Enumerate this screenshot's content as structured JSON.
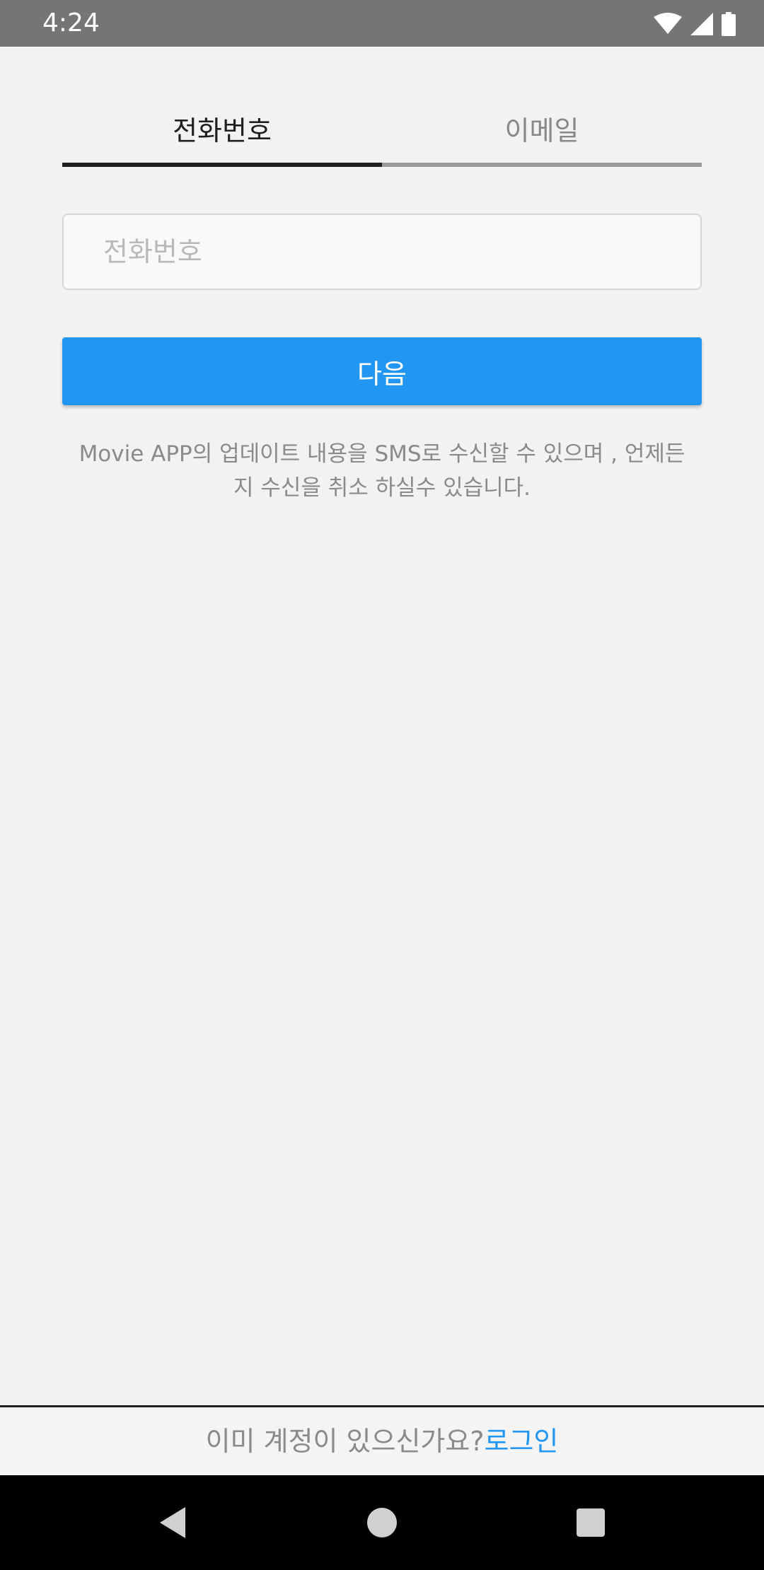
{
  "status_bar": {
    "time": "4:24",
    "icons": [
      "wifi-icon",
      "cell-signal-icon",
      "battery-icon"
    ]
  },
  "tabs": [
    {
      "label": "전화번호",
      "selected": true
    },
    {
      "label": "이메일",
      "selected": false
    }
  ],
  "phone_input": {
    "value": "",
    "placeholder": "전화번호"
  },
  "next_button": {
    "label": "다음"
  },
  "notice": {
    "line1": "Movie APP의 업데이트 내용을 SMS로 수신할 수 있으며 , 언제든",
    "line2": "지 수신을 취소 하실수 있습니다."
  },
  "footer": {
    "question": "이미 계정이 있으신가요?",
    "login_label": "로그인"
  },
  "nav_bar": {
    "icons": [
      "back-icon",
      "home-icon",
      "recents-icon"
    ]
  },
  "colors": {
    "accent": "#2196f3",
    "background": "#f2f2f2",
    "status_bar": "#757575",
    "nav_bar": "#000000"
  }
}
